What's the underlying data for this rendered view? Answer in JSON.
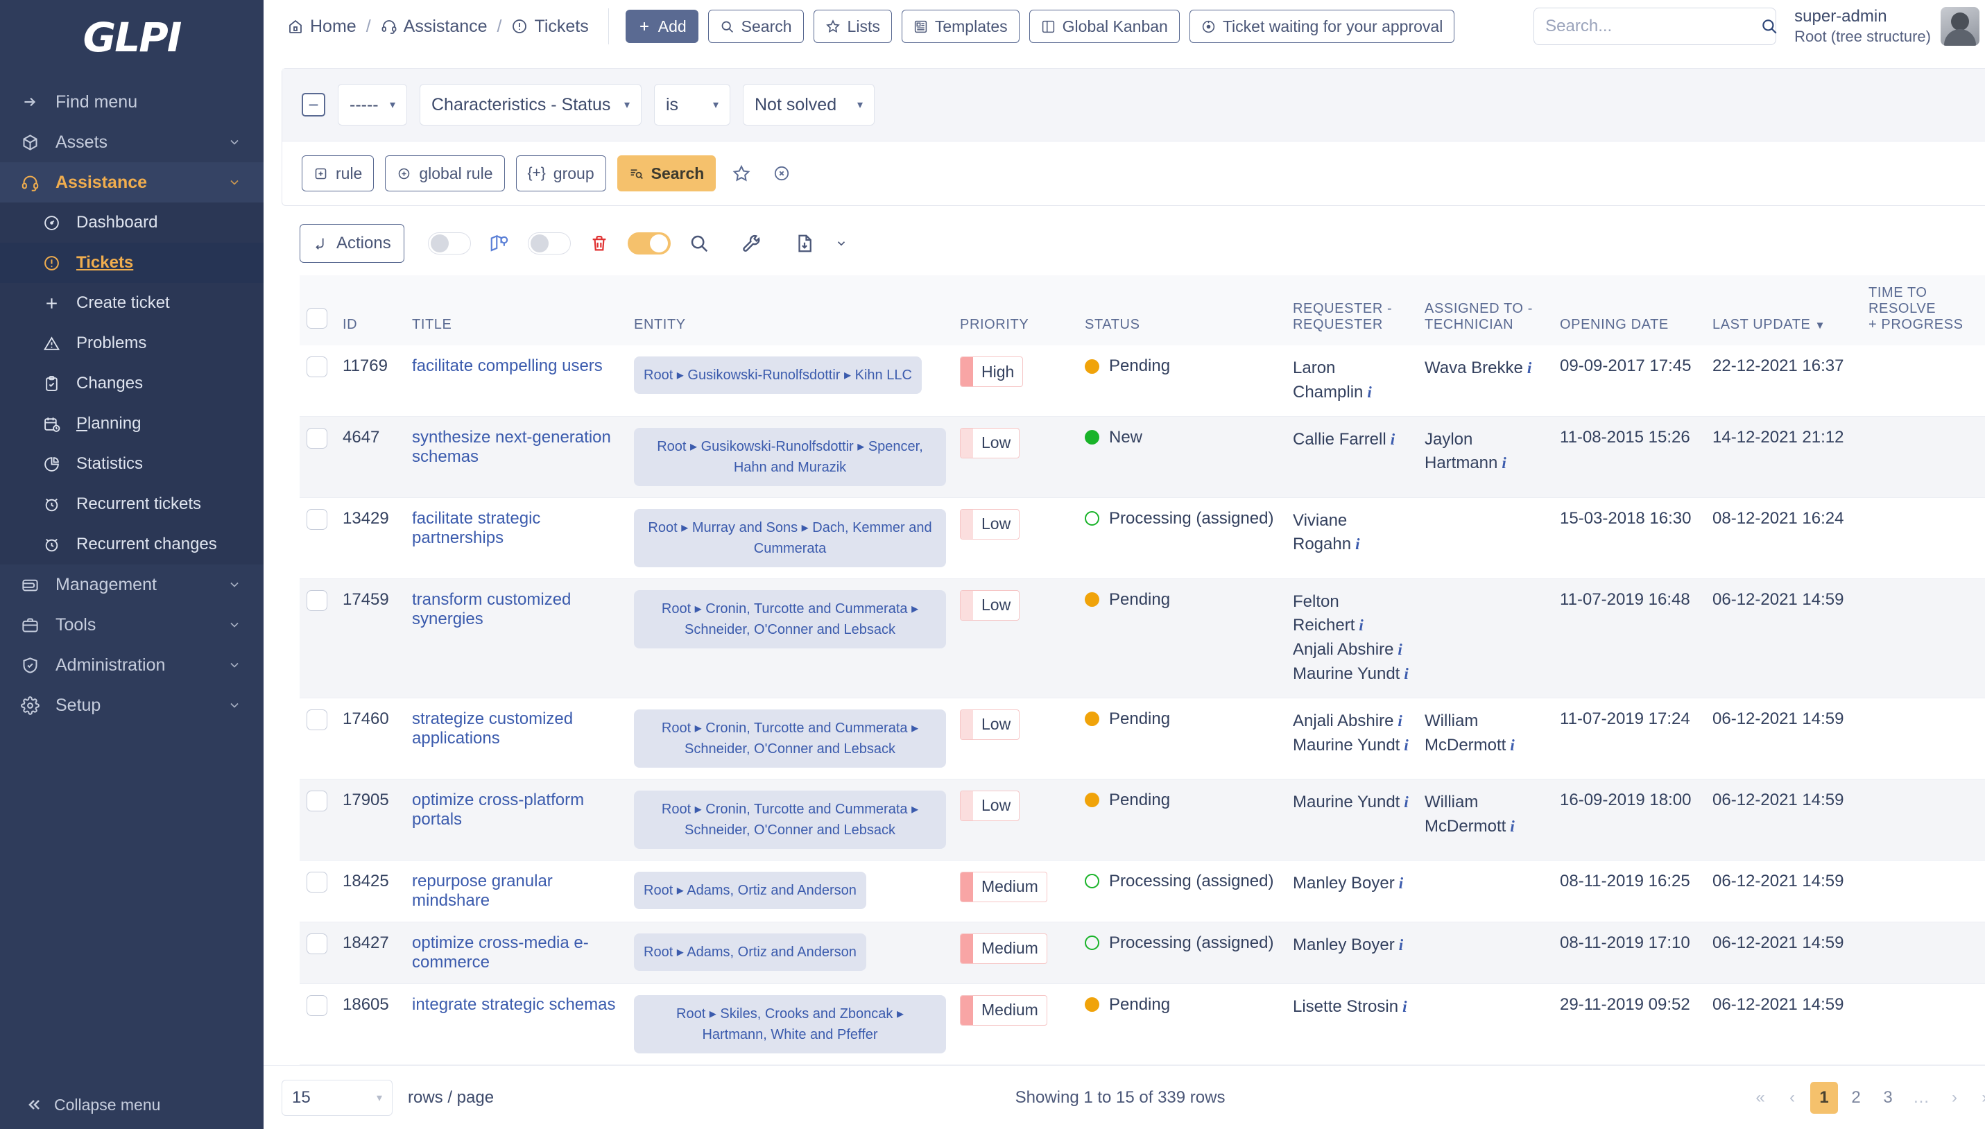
{
  "brand": {
    "logo_text": "GLPI"
  },
  "sidebar": {
    "items": [
      {
        "label": "Find menu",
        "icon": "arrow-right-icon",
        "type": "plain"
      },
      {
        "label": "Assets",
        "icon": "box-icon",
        "type": "group"
      },
      {
        "label": "Assistance",
        "icon": "headset-icon",
        "type": "group-active"
      },
      {
        "label": "Dashboard",
        "icon": "gauge-icon",
        "type": "sub"
      },
      {
        "label": "Tickets",
        "icon": "alert-circle-icon",
        "type": "sub-selected"
      },
      {
        "label": "Create ticket",
        "icon": "plus-icon",
        "type": "sub"
      },
      {
        "label": "Problems",
        "icon": "alert-triangle-icon",
        "type": "sub"
      },
      {
        "label": "Changes",
        "icon": "clipboard-check-icon",
        "type": "sub"
      },
      {
        "label": "Planning",
        "icon": "calendar-clock-icon",
        "type": "sub"
      },
      {
        "label": "Statistics",
        "icon": "pie-chart-icon",
        "type": "sub"
      },
      {
        "label": "Recurrent tickets",
        "icon": "alarm-clock-icon",
        "type": "sub"
      },
      {
        "label": "Recurrent changes",
        "icon": "alarm-clock-icon",
        "type": "sub"
      },
      {
        "label": "Management",
        "icon": "wallet-icon",
        "type": "group"
      },
      {
        "label": "Tools",
        "icon": "briefcase-icon",
        "type": "group"
      },
      {
        "label": "Administration",
        "icon": "shield-check-icon",
        "type": "group"
      },
      {
        "label": "Setup",
        "icon": "gear-icon",
        "type": "group"
      }
    ],
    "collapse_label": "Collapse menu",
    "collapse_icon": "double-chevron-left-icon"
  },
  "topbar": {
    "breadcrumb": [
      {
        "label": "Home",
        "icon": "home-icon"
      },
      {
        "label": "Assistance",
        "icon": "headset-icon"
      },
      {
        "label": "Tickets",
        "icon": "alert-circle-icon"
      }
    ],
    "buttons": [
      {
        "label": "Add",
        "icon": "plus-icon",
        "primary": true
      },
      {
        "label": "Search",
        "icon": "search-icon",
        "primary": false
      },
      {
        "label": "Lists",
        "icon": "star-icon",
        "primary": false
      },
      {
        "label": "Templates",
        "icon": "template-icon",
        "primary": false
      },
      {
        "label": "Global Kanban",
        "icon": "kanban-icon",
        "primary": false
      },
      {
        "label": "Ticket waiting for your approval",
        "icon": "target-icon",
        "primary": false
      }
    ],
    "search": {
      "placeholder": "Search...",
      "value": "",
      "icon": "search-icon"
    },
    "user": {
      "name": "super-admin",
      "entity": "Root (tree structure)",
      "chevron": "chevron-down-icon"
    }
  },
  "filters": {
    "collapse_icon": "minus-square-icon",
    "logic_select": "-----",
    "field_select": "Characteristics - Status",
    "operator_select": "is",
    "value_select": "Not solved",
    "buttons": [
      {
        "label": "rule",
        "icon": "plus-square-icon"
      },
      {
        "label": "global rule",
        "icon": "plus-circle-icon"
      },
      {
        "label": "group",
        "icon": "plus-braces-icon"
      }
    ],
    "search_label": "Search",
    "search_icon": "search-list-icon",
    "star_icon": "star-icon",
    "reset_icon": "reset-circle-icon"
  },
  "toolbar": {
    "actions_label": "Actions",
    "actions_icon": "arrow-corner-icon",
    "toggle1": {
      "on": false,
      "icon": "map-pin-icon"
    },
    "toggle2": {
      "on": false,
      "icon": "trash-icon"
    },
    "toggle3": {
      "on": true,
      "icon": "search-icon"
    },
    "wrench_icon": "wrench-icon",
    "export_icon": "file-download-icon",
    "export_caret": "chevron-down-icon"
  },
  "table": {
    "columns": [
      {
        "top": "",
        "bottom": "ID"
      },
      {
        "top": "",
        "bottom": "TITLE"
      },
      {
        "top": "",
        "bottom": "ENTITY"
      },
      {
        "top": "",
        "bottom": "PRIORITY"
      },
      {
        "top": "",
        "bottom": "STATUS"
      },
      {
        "top": "REQUESTER -",
        "bottom": "REQUESTER"
      },
      {
        "top": "ASSIGNED TO -",
        "bottom": "TECHNICIAN"
      },
      {
        "top": "",
        "bottom": "OPENING DATE"
      },
      {
        "top": "",
        "bottom": "LAST UPDATE",
        "sorted": true,
        "sort_icon": "caret-down-icon"
      },
      {
        "top": "TIME TO RESOLVE",
        "bottom": "+ PROGRESS"
      }
    ],
    "rows": [
      {
        "id": "11769",
        "title": "facilitate compelling users",
        "entity": "Root ▸ Gusikowski-Runolfsdottir ▸ Kihn LLC",
        "priority": "High",
        "priority_color": "#f8a5a5",
        "status": "Pending",
        "status_dot": "filled-orange",
        "requesters": [
          "Laron Champlin"
        ],
        "technicians": [
          "Wava Brekke"
        ],
        "opening_date": "09-09-2017 17:45",
        "last_update": "22-12-2021 16:37",
        "time_to_resolve": ""
      },
      {
        "id": "4647",
        "title": "synthesize next-generation schemas",
        "entity": "Root ▸ Gusikowski-Runolfsdottir ▸ Spencer, Hahn and Murazik",
        "priority": "Low",
        "priority_color": "#fbdede",
        "status": "New",
        "status_dot": "filled-green",
        "requesters": [
          "Callie Farrell"
        ],
        "technicians": [
          "Jaylon Hartmann"
        ],
        "opening_date": "11-08-2015 15:26",
        "last_update": "14-12-2021 21:12",
        "time_to_resolve": ""
      },
      {
        "id": "13429",
        "title": "facilitate strategic partnerships",
        "entity": "Root ▸ Murray and Sons ▸ Dach, Kemmer and Cummerata",
        "priority": "Low",
        "priority_color": "#fbdede",
        "status": "Processing (assigned)",
        "status_dot": "ring-green",
        "requesters": [
          "Viviane Rogahn"
        ],
        "technicians": [],
        "opening_date": "15-03-2018 16:30",
        "last_update": "08-12-2021 16:24",
        "time_to_resolve": ""
      },
      {
        "id": "17459",
        "title": "transform customized synergies",
        "entity": "Root ▸ Cronin, Turcotte and Cummerata ▸ Schneider, O'Conner and Lebsack",
        "priority": "Low",
        "priority_color": "#fbdede",
        "status": "Pending",
        "status_dot": "filled-orange",
        "requesters": [
          "Felton Reichert",
          "Anjali Abshire",
          "Maurine Yundt"
        ],
        "technicians": [],
        "opening_date": "11-07-2019 16:48",
        "last_update": "06-12-2021 14:59",
        "time_to_resolve": ""
      },
      {
        "id": "17460",
        "title": "strategize customized applications",
        "entity": "Root ▸ Cronin, Turcotte and Cummerata ▸ Schneider, O'Conner and Lebsack",
        "priority": "Low",
        "priority_color": "#fbdede",
        "status": "Pending",
        "status_dot": "filled-orange",
        "requesters": [
          "Anjali Abshire",
          "Maurine Yundt"
        ],
        "technicians": [
          "William McDermott"
        ],
        "opening_date": "11-07-2019 17:24",
        "last_update": "06-12-2021 14:59",
        "time_to_resolve": ""
      },
      {
        "id": "17905",
        "title": "optimize cross-platform portals",
        "entity": "Root ▸ Cronin, Turcotte and Cummerata ▸ Schneider, O'Conner and Lebsack",
        "priority": "Low",
        "priority_color": "#fbdede",
        "status": "Pending",
        "status_dot": "filled-orange",
        "requesters": [
          "Maurine Yundt"
        ],
        "technicians": [
          "William McDermott"
        ],
        "opening_date": "16-09-2019 18:00",
        "last_update": "06-12-2021 14:59",
        "time_to_resolve": ""
      },
      {
        "id": "18425",
        "title": "repurpose granular mindshare",
        "entity": "Root ▸ Adams, Ortiz and Anderson",
        "priority": "Medium",
        "priority_color": "#f8a5a5",
        "status": "Processing (assigned)",
        "status_dot": "ring-green",
        "requesters": [
          "Manley Boyer"
        ],
        "technicians": [],
        "opening_date": "08-11-2019 16:25",
        "last_update": "06-12-2021 14:59",
        "time_to_resolve": ""
      },
      {
        "id": "18427",
        "title": "optimize cross-media e-commerce",
        "entity": "Root ▸ Adams, Ortiz and Anderson",
        "priority": "Medium",
        "priority_color": "#f8a5a5",
        "status": "Processing (assigned)",
        "status_dot": "ring-green",
        "requesters": [
          "Manley Boyer"
        ],
        "technicians": [],
        "opening_date": "08-11-2019 17:10",
        "last_update": "06-12-2021 14:59",
        "time_to_resolve": ""
      },
      {
        "id": "18605",
        "title": "integrate strategic schemas",
        "entity": "Root ▸ Skiles, Crooks and Zboncak ▸ Hartmann, White and Pfeffer",
        "priority": "Medium",
        "priority_color": "#f8a5a5",
        "status": "Pending",
        "status_dot": "filled-orange",
        "requesters": [
          "Lisette Strosin"
        ],
        "technicians": [],
        "opening_date": "29-11-2019 09:52",
        "last_update": "06-12-2021 14:59",
        "time_to_resolve": ""
      }
    ]
  },
  "footer": {
    "rows_per_page": "15",
    "rows_label": "rows / page",
    "showing": "Showing 1 to 15 of 339 rows",
    "pages": [
      {
        "label": "«",
        "type": "first"
      },
      {
        "label": "‹",
        "type": "prev"
      },
      {
        "label": "1",
        "type": "page",
        "current": true
      },
      {
        "label": "2",
        "type": "page"
      },
      {
        "label": "3",
        "type": "page"
      },
      {
        "label": "…",
        "type": "ellipsis"
      },
      {
        "label": "›",
        "type": "next"
      },
      {
        "label": "»",
        "type": "last"
      }
    ]
  }
}
